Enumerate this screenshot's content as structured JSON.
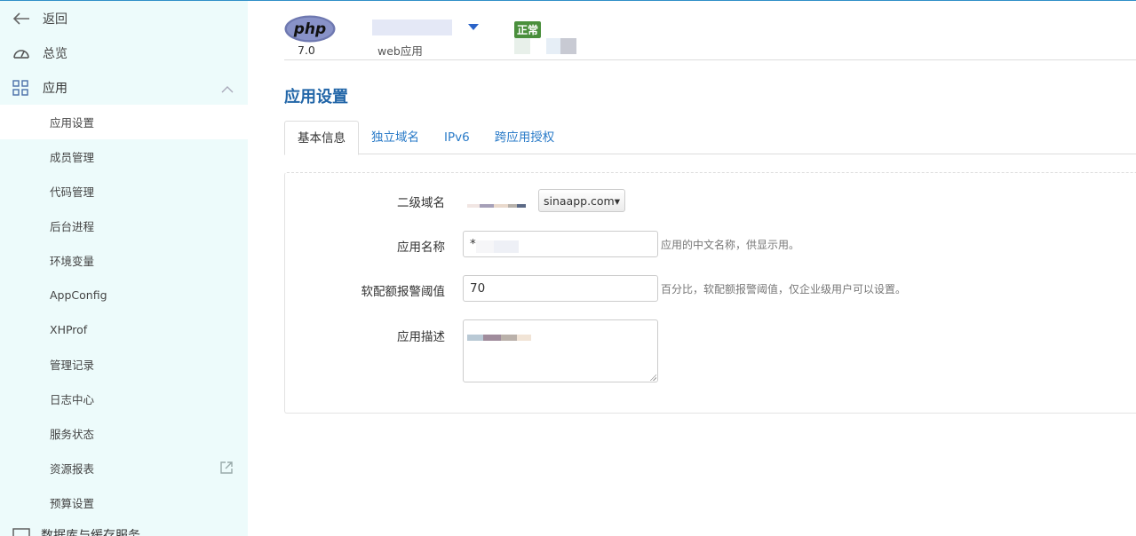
{
  "sidebar": {
    "back_label": "返回",
    "overview_label": "总览",
    "apps_label": "应用",
    "items": [
      {
        "label": "应用设置",
        "active": true
      },
      {
        "label": "成员管理"
      },
      {
        "label": "代码管理"
      },
      {
        "label": "后台进程"
      },
      {
        "label": "环境变量"
      },
      {
        "label": "AppConfig"
      },
      {
        "label": "XHProf"
      },
      {
        "label": "管理记录"
      },
      {
        "label": "日志中心"
      },
      {
        "label": "服务状态"
      },
      {
        "label": "资源报表",
        "external_icon": "external-link-icon"
      },
      {
        "label": "预算设置"
      }
    ],
    "next_group_label": "数据库与缓存服务"
  },
  "app": {
    "runtime_logo": "php",
    "runtime_version": "7.0",
    "type": "web应用",
    "status": "正常",
    "status_color": "#4a8f3c"
  },
  "page": {
    "title": "应用设置",
    "tabs": [
      {
        "label": "基本信息",
        "active": true
      },
      {
        "label": "独立域名"
      },
      {
        "label": "IPv6"
      },
      {
        "label": "跨应用授权"
      }
    ]
  },
  "form": {
    "subdomain_label": "二级域名",
    "subdomain_suffix": "sinaapp.com▾",
    "app_name_label": "应用名称",
    "app_name_value": "*",
    "app_name_hint": "应用的中文名称，供显示用。",
    "quota_label": "软配额报警阈值",
    "quota_value": "70",
    "quota_hint": "百分比，软配额报警阈值，仅企业级用户可以设置。",
    "desc_label": "应用描述"
  },
  "colors": {
    "accent": "#2266a8",
    "link": "#2a7bc8",
    "sidebar_bg": "#edfbfb"
  }
}
